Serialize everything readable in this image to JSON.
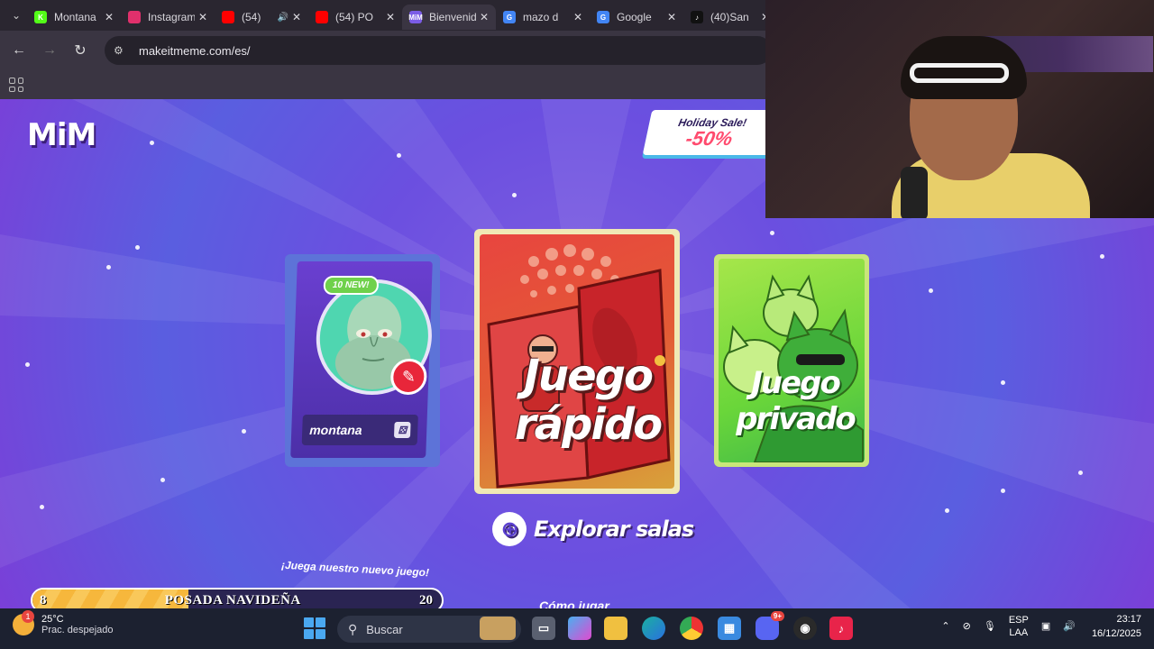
{
  "browser": {
    "tabs": [
      {
        "title": "Montana",
        "favicon": "K",
        "color": "#53fc18",
        "active": false
      },
      {
        "title": "Instagram",
        "favicon": "",
        "color": "#e1306c",
        "active": false
      },
      {
        "title": "(54)",
        "favicon": "",
        "color": "#ff0000",
        "active": false,
        "audio": true
      },
      {
        "title": "(54) PO",
        "favicon": "",
        "color": "#ff0000",
        "active": false
      },
      {
        "title": "Bienvenid",
        "favicon": "MiM",
        "color": "#7b5ce6",
        "active": true
      },
      {
        "title": "mazo d",
        "favicon": "G",
        "color": "#4285f4",
        "active": false
      },
      {
        "title": "Google",
        "favicon": "G",
        "color": "#4285f4",
        "active": false
      },
      {
        "title": "(40)San",
        "favicon": "♪",
        "color": "#111111",
        "active": false
      }
    ],
    "url": "makeitmeme.com/es/"
  },
  "page": {
    "logo": "MiM",
    "sale": {
      "line1": "Holiday Sale!",
      "line2": "-50%"
    },
    "profile": {
      "badge": "10 NEW!",
      "username": "montana"
    },
    "quick_play": {
      "line1": "Juego",
      "line2": "rápido"
    },
    "private_play": {
      "line1": "Juego",
      "line2": "privado"
    },
    "explore": "Explorar salas",
    "promo": "¡Juega nuestro nuevo juego!",
    "howto": "Cómo jugar"
  },
  "event": {
    "level": "8",
    "label": "POSADA NAVIDEÑA",
    "max": "20",
    "progress": 0.38
  },
  "taskbar": {
    "weather": {
      "temp": "25°C",
      "desc": "Prac. despejado",
      "notif": "1"
    },
    "search_placeholder": "Buscar",
    "lang": {
      "line1": "ESP",
      "line2": "LAA"
    },
    "time": "23:17",
    "date": "16/12/2025",
    "discord_badge": "9+"
  }
}
